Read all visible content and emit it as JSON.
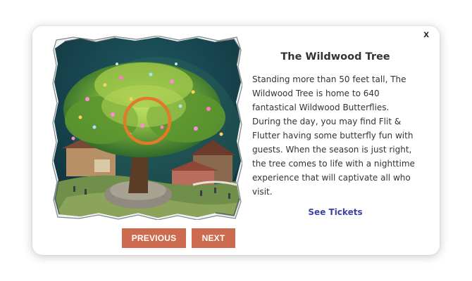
{
  "modal": {
    "close_label": "x",
    "title": "The Wildwood Tree",
    "description": "Standing more than 50 feet tall, The Wildwood Tree is home to 640 fantastical Wildwood Butterflies. During the day, you may find Flit & Flutter having some butterfly fun with guests. When the season is just right, the tree comes to life with a nighttime experience that will captivate all who visit.",
    "tickets_link": "See Tickets",
    "previous_label": "PREVIOUS",
    "next_label": "NEXT"
  },
  "colors": {
    "button_bg": "#cc6b4e",
    "link": "#3a43a8",
    "text": "#333333",
    "highlight_ring": "#e07b2a"
  },
  "image": {
    "subject": "illustration-wildwood-tree-with-butterflies"
  }
}
